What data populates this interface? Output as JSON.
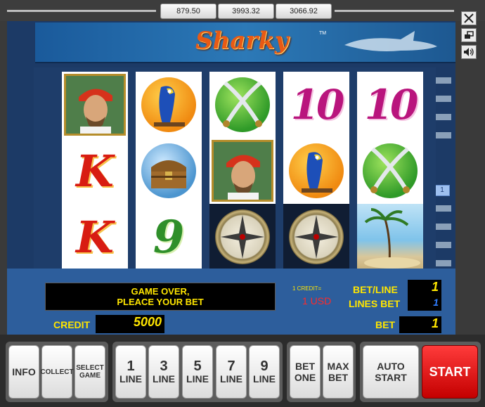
{
  "top_counters": [
    "879.50",
    "3993.32",
    "3066.92"
  ],
  "window_controls": {
    "close_icon": "close-icon",
    "minimize_icon": "window-restore-icon",
    "sound_icon": "speaker-icon"
  },
  "banner": {
    "logo_text": "Sharky",
    "tm": "TM"
  },
  "line_markers": {
    "left": "1",
    "right": "1"
  },
  "reels": [
    [
      "pirate",
      "K",
      "K"
    ],
    [
      "parrot",
      "treasure-chest",
      "9"
    ],
    [
      "crossed-swords",
      "pirate",
      "compass"
    ],
    [
      "10",
      "parrot",
      "compass"
    ],
    [
      "10",
      "crossed-swords",
      "beach-island"
    ]
  ],
  "panel": {
    "message_line1": "GAME OVER,",
    "message_line2": "PLEACE YOUR BET",
    "credit_label": "CREDIT",
    "credit_value": "5000",
    "denom_label": "1 CREDIT=",
    "denom_value": "1 USD",
    "bet_line_label": "BET/LINE",
    "bet_line_value": "1",
    "lines_bet_label": "LINES BET",
    "lines_bet_value": "1",
    "bet_label": "BET",
    "bet_value": "1"
  },
  "buttons": {
    "info": "INFO",
    "collect": "COLLECT",
    "select_game_1": "SELECT",
    "select_game_2": "GAME",
    "line_word": "LINE",
    "line_values": [
      "1",
      "3",
      "5",
      "7",
      "9"
    ],
    "bet_one_1": "BET",
    "bet_one_2": "ONE",
    "max_bet_1": "MAX",
    "max_bet_2": "BET",
    "auto_start_1": "AUTO",
    "auto_start_2": "START",
    "start": "START"
  },
  "colors": {
    "panel_blue": "#2d5e9c",
    "digit_yellow": "#ffe600",
    "start_red": "#e01010"
  }
}
